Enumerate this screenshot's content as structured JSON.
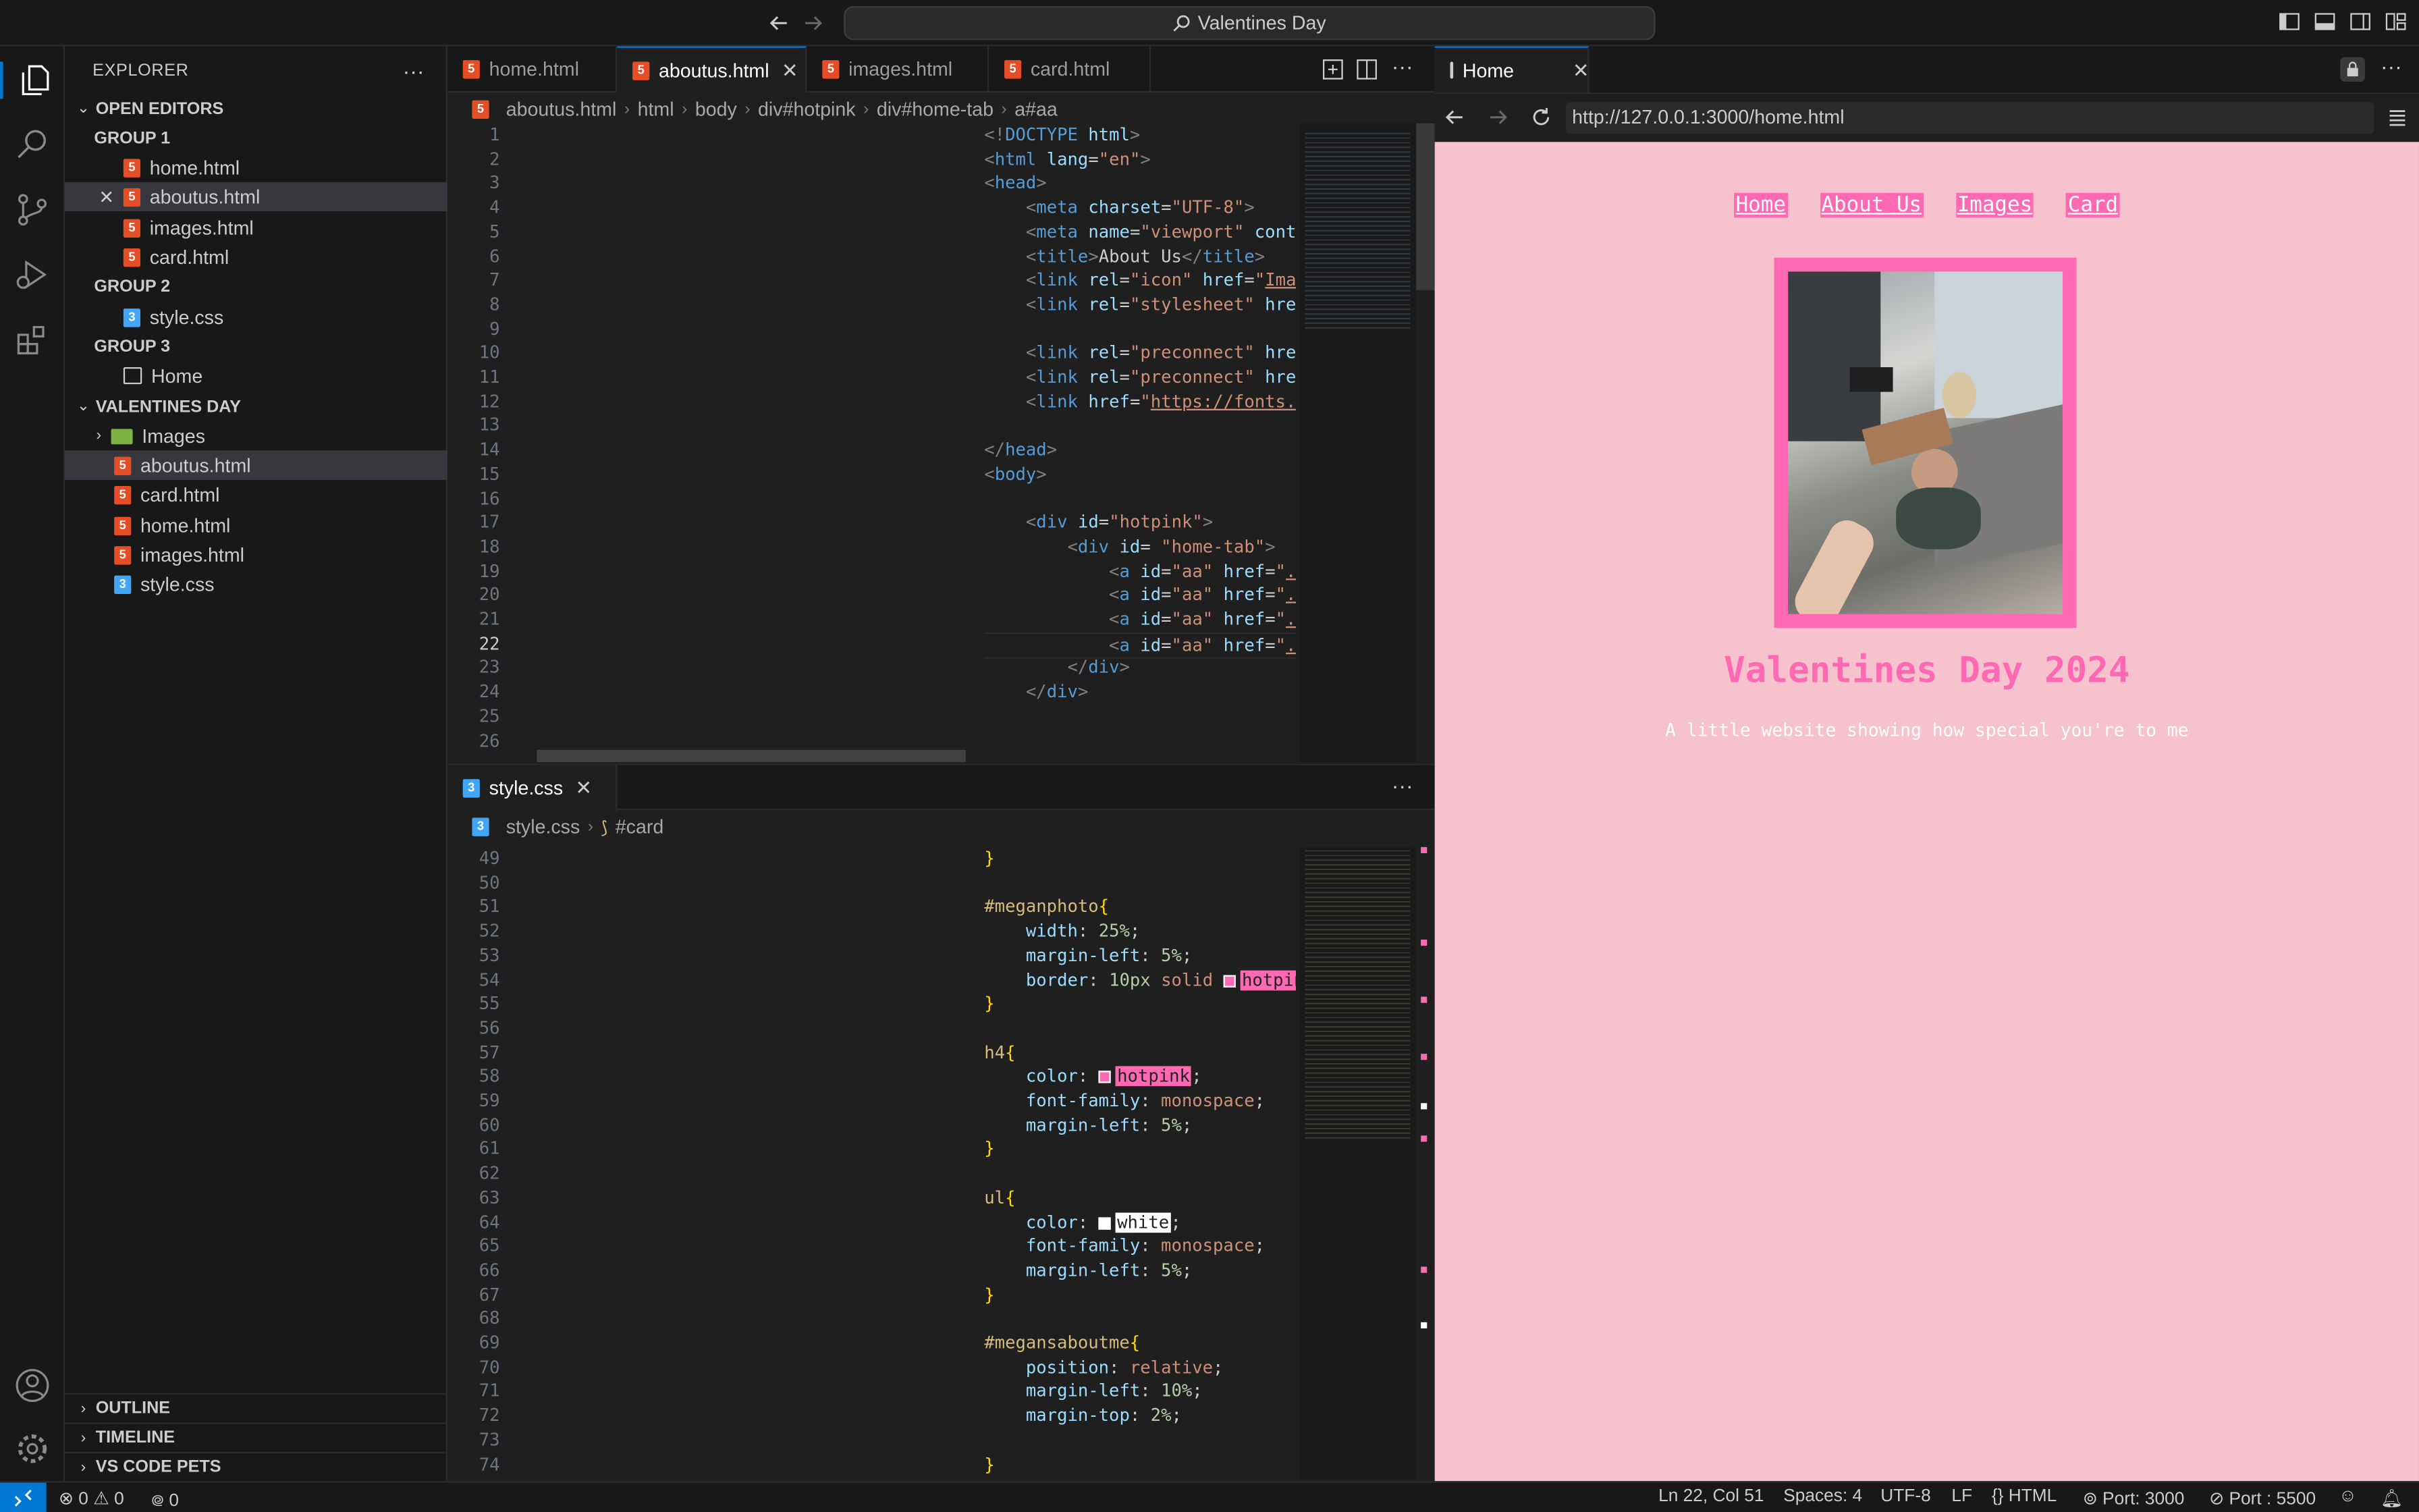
{
  "titlebar": {
    "search_text": "Valentines Day"
  },
  "explorer": {
    "title": "EXPLORER",
    "more": "···",
    "open_editors": {
      "label": "OPEN EDITORS",
      "group1": {
        "label": "GROUP 1",
        "files": [
          "home.html",
          "aboutus.html",
          "images.html",
          "card.html"
        ]
      },
      "group2": {
        "label": "GROUP 2",
        "files": [
          "style.css"
        ]
      },
      "group3": {
        "label": "GROUP 3",
        "files": [
          "Home"
        ]
      }
    },
    "project": {
      "label": "VALENTINES DAY",
      "folder": "Images",
      "files": [
        "aboutus.html",
        "card.html",
        "home.html",
        "images.html",
        "style.css"
      ]
    },
    "outline": "OUTLINE",
    "timeline": "TIMELINE",
    "pets": "VS CODE PETS"
  },
  "editor_top": {
    "tabs": [
      "home.html",
      "aboutus.html",
      "images.html",
      "card.html"
    ],
    "active_tab": "aboutus.html",
    "breadcrumb": [
      "aboutus.html",
      "html",
      "body",
      "div#hotpink",
      "div#home-tab",
      "a#aa"
    ],
    "line_numbers": [
      "1",
      "2",
      "3",
      "4",
      "5",
      "6",
      "7",
      "8",
      "9",
      "10",
      "11",
      "12",
      "13",
      "14",
      "15",
      "16",
      "17",
      "18",
      "19",
      "20",
      "21",
      "22",
      "23",
      "24",
      "25",
      "26"
    ]
  },
  "editor_bottom": {
    "tab": "style.css",
    "breadcrumb": [
      "style.css",
      "#card"
    ],
    "line_numbers": [
      "49",
      "50",
      "51",
      "52",
      "53",
      "54",
      "55",
      "56",
      "57",
      "58",
      "59",
      "60",
      "61",
      "62",
      "63",
      "64",
      "65",
      "66",
      "67",
      "68",
      "69",
      "70",
      "71",
      "72",
      "73",
      "74"
    ]
  },
  "preview": {
    "tab": "Home",
    "url": "http://127.0.0.1:3000/home.html",
    "nav_links": [
      "Home",
      "About Us",
      "Images",
      "Card"
    ],
    "heading": "Valentines Day 2024",
    "subheading": "A little website showing how special you're to me"
  },
  "statusbar": {
    "errors": "0",
    "warnings": "0",
    "ports": "0",
    "position": "Ln 22, Col 51",
    "spaces": "Spaces: 4",
    "encoding": "UTF-8",
    "eol": "LF",
    "language": "HTML",
    "port": "Port: 3000",
    "port2": "Port : 5500"
  },
  "colors": {
    "accent": "#0078d4",
    "hotpink": "#ff69b4",
    "page_bg": "#f5c2cd"
  }
}
